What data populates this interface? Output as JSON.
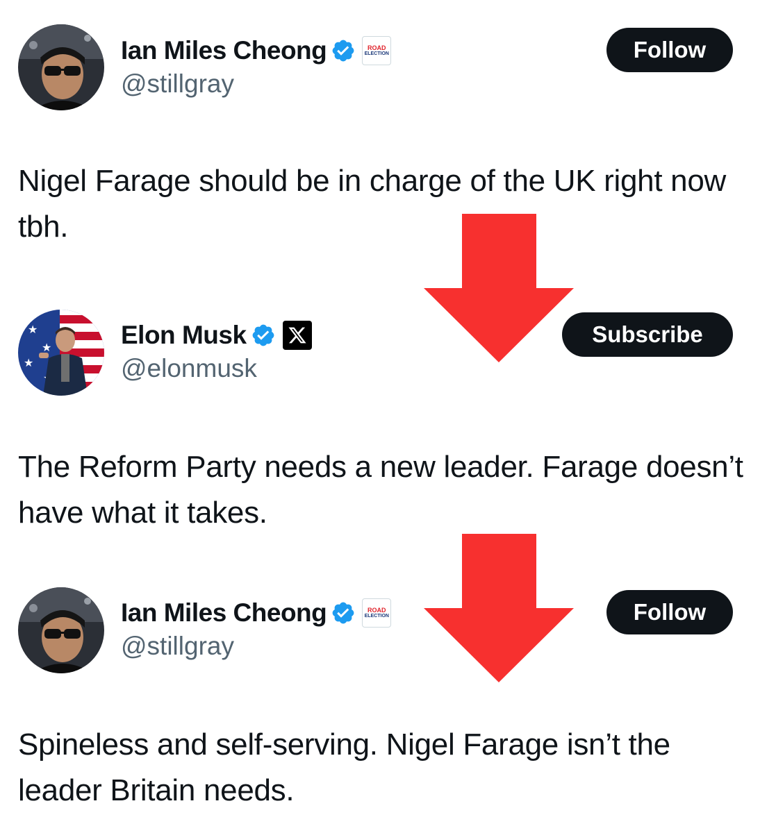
{
  "tweets": [
    {
      "display_name": "Ian Miles Cheong",
      "handle": "@stillgray",
      "verified": true,
      "affiliate_badge": {
        "top": "ROAD",
        "bottom": "ELECTION"
      },
      "action_label": "Follow",
      "text": "Nigel Farage should be in charge of the UK right now tbh."
    },
    {
      "display_name": "Elon Musk",
      "handle": "@elonmusk",
      "verified": true,
      "affiliate_badge": {
        "icon": "x-logo-icon"
      },
      "action_label": "Subscribe",
      "text": "The Reform Party needs a new leader. Farage doesn’t have what it takes."
    },
    {
      "display_name": "Ian Miles Cheong",
      "handle": "@stillgray",
      "verified": true,
      "affiliate_badge": {
        "top": "ROAD",
        "bottom": "ELECTION"
      },
      "action_label": "Follow",
      "text": "Spineless and self-serving. Nigel Farage isn’t the leader Britain needs."
    }
  ],
  "colors": {
    "verified_blue": "#1d9bf0",
    "arrow_red": "#f7302f",
    "button_bg": "#0f1419",
    "handle_gray": "#536471"
  },
  "icons": {
    "verified": "verified-badge-icon",
    "arrow": "down-arrow-icon"
  }
}
